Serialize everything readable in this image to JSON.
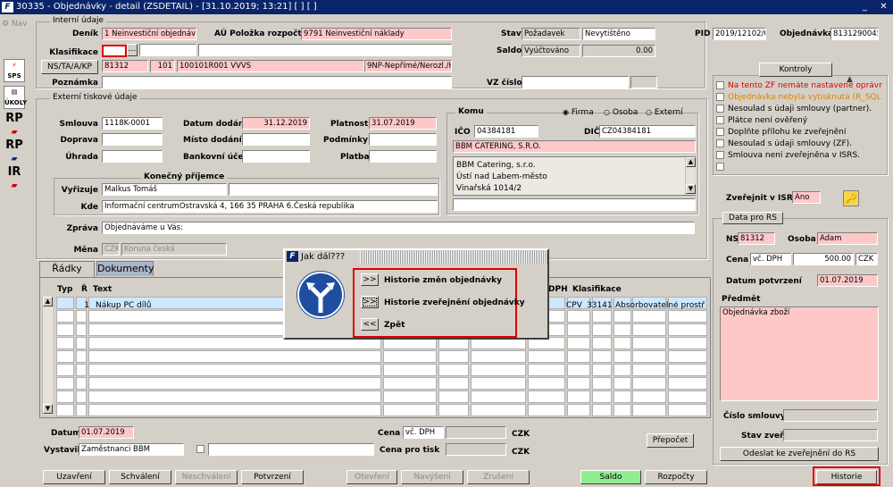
{
  "title": "30335 - Objednávky - detail (ZSDETAIL) - [31.10.2019; 13:21] [ ] [ ]",
  "window_controls": {
    "minimize": "_",
    "close": "✕"
  },
  "nav_label": "Nav",
  "side_icons": {
    "sps": "SPS",
    "ukoly": "ÚKOLY",
    "rp1": "RP",
    "rp2": "RP",
    "ir": "IR"
  },
  "interni": {
    "title": "Interní údaje",
    "denik_label": "Deník",
    "denik_value": "1 Neinvestiční objednávky",
    "au_label": "AÚ Položka rozpočtu",
    "au_value": "9791 Neinvestiční náklady",
    "klasifikace_label": "Klasifikace",
    "klasifikace_dots": "…",
    "nstaakp_button": "NS/TA/A/KP",
    "ns_value": "81312",
    "ta_value": "101",
    "a_value": "100101R001 VVVS",
    "kp_value": "9NP-Nepřímé/Nerozl./HČ",
    "poznamka_label": "Poznámka",
    "stav_label": "Stav",
    "stav_value": "Požadavek",
    "stav2_value": "Nevytištěno",
    "saldo_label": "Saldo",
    "saldo_value": "Vyúčtováno",
    "saldo_amount": "0.00",
    "vz_label": "VZ číslo",
    "pid_label": "PID",
    "pid_value": "2019/12102/0(",
    "objednavka_label": "Objednávka",
    "objednavka_value": "8131290045"
  },
  "externi": {
    "title": "Externí tiskové údaje",
    "smlouva_label": "Smlouva",
    "smlouva_value": "1118K-0001",
    "datum_dodani_label": "Datum dodání",
    "datum_dodani_value": "31.12.2019",
    "platnost_label": "Platnost",
    "platnost_value": "31.07.2019",
    "doprava_label": "Doprava",
    "misto_dodani_label": "Místo dodání",
    "podminky_label": "Podmínky",
    "uhrada_label": "Úhrada",
    "bankovni_ucet_label": "Bankovní účet",
    "platba_label": "Platba"
  },
  "komu": {
    "title": "Komu",
    "radio_firma": "Firma",
    "radio_osoba": "Osoba",
    "radio_externi": "Externí",
    "ico_label": "IČO",
    "ico_value": "04384181",
    "dic_label": "DIČ",
    "dic_value": "CZ04384181",
    "firma_value": "BBM CATERING, S.R.O.",
    "address_lines": [
      "BBM Catering, s.r.o.",
      "Ústí nad Labem-město",
      "Vinařská 1014/2"
    ]
  },
  "konecny": {
    "title": "Konečný příjemce",
    "vyrizuje_label": "Vyřizuje",
    "vyrizuje_value": "Malkus Tomáš",
    "kde_label": "Kde",
    "kde_value": "Informační centrumOstravská 4, 166 35 PRAHA 6.Česká republika"
  },
  "zprava_label": "Zpráva",
  "zprava_value": "Objednáváme u Vás:",
  "mena_label": "Měna",
  "mena_code": "CZK",
  "mena_name": "Koruna česká",
  "tabs": [
    "Řádky",
    "Dokumenty"
  ],
  "grid": {
    "headers": {
      "typ": "Typ",
      "r": "Ř",
      "text": "Text",
      "dph": "DPH",
      "klasifikace": "Klasifikace"
    },
    "row1": {
      "r": "1",
      "text": "Nákup PC dílů",
      "dph": "CPV",
      "kod": "331411",
      "popis": "Absorbovatelné prostředl"
    }
  },
  "bottom": {
    "datum_label": "Datum",
    "datum_value": "01.07.2019",
    "vystavil_label": "Vystavil",
    "vystavil_value": "Zaměstnanci BBM",
    "cena_label": "Cena",
    "cena_value": "vč. DPH",
    "cena_currency": "CZK",
    "cena_tisk_label": "Cena pro tisk",
    "cena_tisk_currency": "CZK",
    "prepocet": "Přepočet"
  },
  "kontroly": {
    "button": "Kontroly",
    "items": [
      "Na tento ZF nemáte nastavené oprávnění",
      "Objednávka nebyla vytisknutá (R_SQL O",
      "Nesoulad s údaji smlouvy (partner).",
      "Plátce není ověřený",
      "Doplňte přílohu ke zveřejnění",
      "Nesoulad s údaji smlouvy (ZF).",
      "Smlouva není zveřejněna v ISRS.",
      ""
    ],
    "colors": [
      "#e00000",
      "#e08000",
      "#000000",
      "#000000",
      "#000000",
      "#000000",
      "#000000",
      "#000000"
    ]
  },
  "isrs": {
    "label": "Zveřejnit v ISRS",
    "value": "Ano"
  },
  "data_rs": {
    "title": "Data pro RS",
    "ns_label": "NS",
    "ns_value": "81312",
    "osoba_label": "Osoba",
    "osoba_value": "Adam",
    "cena_label": "Cena",
    "cena_type": "vč. DPH",
    "cena_value": "500.00",
    "cena_currency": "CZK",
    "datum_potvrzeni_label": "Datum potvrzení",
    "datum_potvrzeni_value": "01.07.2019",
    "predmet_label": "Předmět",
    "predmet_value": "Objednávka zboží",
    "cislo_smlouvy_label": "Číslo smlouvy",
    "stav_zver_label": "Stav zveř.",
    "odeslat_button": "Odeslat ke zveřejnění do RS"
  },
  "dialog": {
    "title": "Jak dál???",
    "options": [
      {
        "btn": ">>",
        "label": "Historie změn objednávky"
      },
      {
        "btn": ">>",
        "label": "Historie zveřejnění objednávky"
      },
      {
        "btn": "<<",
        "label": "Zpět"
      }
    ]
  },
  "footer": {
    "uzavreni": "Uzavření",
    "schvaleni": "Schválení",
    "neschvaleni": "Neschválení",
    "potvrzeni": "Potvrzení",
    "otevreni": "Otevření",
    "navyseni": "Navýšení",
    "zruseni": "Zrušení",
    "saldo": "Saldo",
    "rozpocty": "Rozpočty",
    "historie": "Historie"
  },
  "colors": {
    "title_bar": "#0a246a",
    "required_field": "#ffc8c8",
    "highlight": "#e00000",
    "saldo_button": "#90ee90",
    "selected_row": "#cde8ff"
  }
}
